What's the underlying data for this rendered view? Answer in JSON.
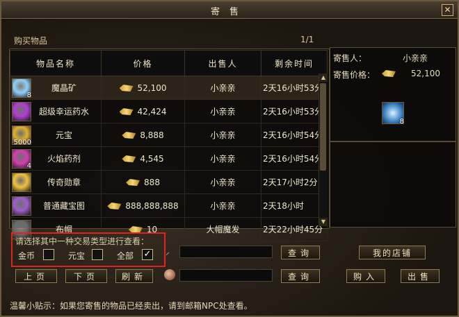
{
  "window": {
    "title": "寄售",
    "close_glyph": "✕"
  },
  "header": {
    "section_label": "购买物品",
    "page_indicator": "1/1"
  },
  "table": {
    "columns": [
      "物品名称",
      "价格",
      "出售人",
      "剩余时间"
    ],
    "rows": [
      {
        "icon": "crystal-ore-icon",
        "qty": "8",
        "name": "魔晶矿",
        "price": "52,100",
        "seller": "小亲亲",
        "time": "2天16小时53分",
        "selected": true,
        "color": "#8fd0ff"
      },
      {
        "icon": "potion-purple-icon",
        "qty": "",
        "name": "超级幸运药水",
        "price": "42,424",
        "seller": "小亲亲",
        "time": "2天16小时53分",
        "color": "#b040d0"
      },
      {
        "icon": "gold-ingot-icon",
        "qty": "5000",
        "name": "元宝",
        "price": "8,888",
        "seller": "小亲亲",
        "time": "2天16小时54分",
        "color": "#e0b030"
      },
      {
        "icon": "flame-potion-icon",
        "qty": "4",
        "name": "火焰药剂",
        "price": "4,545",
        "seller": "小亲亲",
        "time": "2天16小时54分",
        "color": "#d040b0"
      },
      {
        "icon": "medal-icon",
        "qty": "",
        "name": "传奇勋章",
        "price": "888",
        "seller": "小亲亲",
        "time": "2天17小时2分",
        "color": "#f0c040"
      },
      {
        "icon": "treasure-map-icon",
        "qty": "",
        "name": "普通藏宝图",
        "price": "888,888,888",
        "seller": "小亲亲",
        "time": "2天18小时",
        "color": "#9a60c8"
      },
      {
        "icon": "cloth-icon",
        "qty": "",
        "name": "布帽",
        "price": "10",
        "seller": "大帽魔发",
        "time": "2天22小时45分",
        "color": "#6a6a6a"
      }
    ]
  },
  "detail": {
    "seller_label": "寄售人：",
    "seller_value": "小亲亲",
    "price_label": "寄售价格：",
    "price_value": "52,100",
    "item_qty": "8"
  },
  "filter": {
    "prompt": "请选择其中一种交易类型进行查看：",
    "options": [
      {
        "label": "金币",
        "checked": false
      },
      {
        "label": "元宝",
        "checked": false
      },
      {
        "label": "全部",
        "checked": true
      }
    ],
    "check_glyph": "✓"
  },
  "buttons": {
    "query1": "查询",
    "my_shop": "我的店铺",
    "prev_page": "上页",
    "next_page": "下页",
    "refresh": "刷新",
    "query2": "查询",
    "buy": "购入",
    "sell": "出售"
  },
  "tip": "温馨小贴示：如果您寄售的物品已经卖出，请到邮箱NPC处查看。"
}
